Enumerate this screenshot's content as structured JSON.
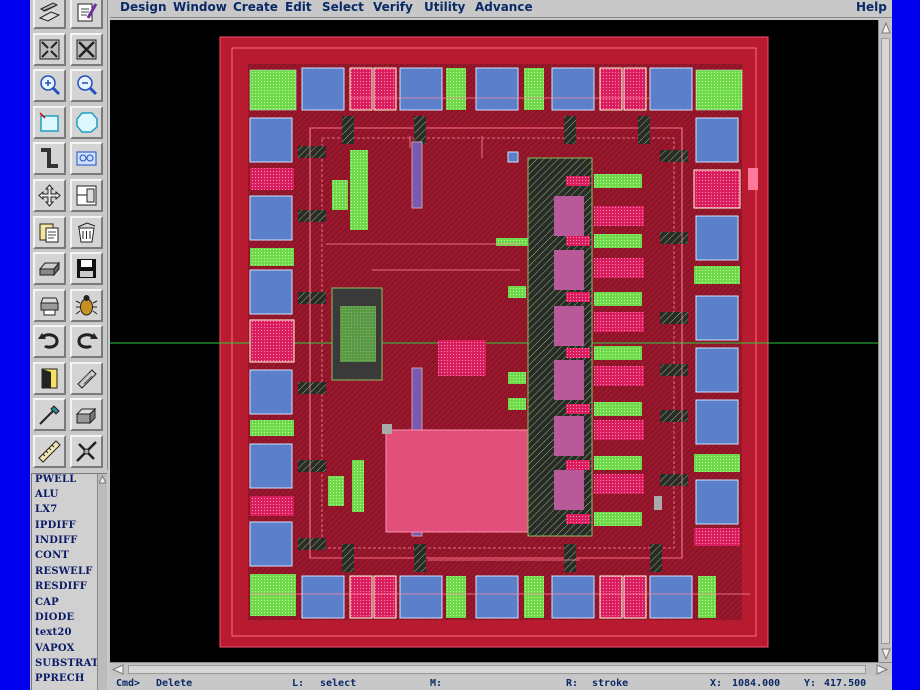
{
  "menu": [
    "Design",
    "Window",
    "Create",
    "Edit",
    "Select",
    "Verify",
    "Utility",
    "Advance"
  ],
  "help": "Help",
  "tools": [
    "layer-stack-icon",
    "edit-icon",
    "fit-icon",
    "zoom-box-icon",
    "zoom-in-icon",
    "zoom-out-icon",
    "box-icon",
    "polygon-icon",
    "path-icon",
    "via-icon",
    "move-icon",
    "copy-cell-icon",
    "paste-icon",
    "delete-icon",
    "hdd-icon",
    "save-icon",
    "print-icon",
    "bug-icon",
    "undo-icon",
    "redo-icon",
    "door-icon",
    "brush-icon",
    "probe-icon",
    "3d-stack-icon",
    "ruler-icon",
    "cross-tool-icon"
  ],
  "layers": [
    "PWELL",
    "ALU",
    "LX7",
    "IPDIFF",
    "INDIFF",
    "CONT",
    "RESWELF",
    "RESDIFF",
    "CAP",
    "DIODE",
    "text20",
    "VAPOX",
    "SUBSTRATE",
    "PPRECH"
  ],
  "status": {
    "cmd_label": "Cmd>",
    "cmd_value": "Delete",
    "l_label": "L:",
    "l_value": "select",
    "m_label": "M:",
    "m_value": "",
    "r_label": "R:",
    "r_value": "stroke",
    "x_label": "X:",
    "x_value": "1084.000",
    "y_label": "Y:",
    "y_value": "417.500"
  },
  "colors": {
    "chip_border": "#b81a30",
    "chip_core": "#8a1426",
    "pad_metal": "#5b7fc9",
    "diffusion": "#7ee05a",
    "poly": "#e8286a",
    "crosshair": "#2ecc40"
  }
}
